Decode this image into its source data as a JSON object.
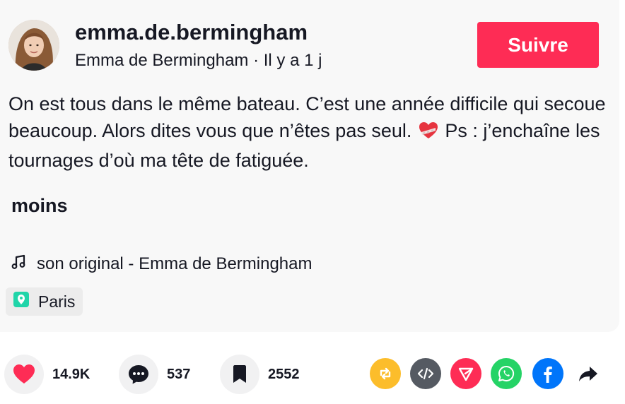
{
  "author": {
    "username": "emma.de.bermingham",
    "display_name": "Emma de Bermingham",
    "time_ago": "Il y a 1 j",
    "meta_separator": " · "
  },
  "follow_label": "Suivre",
  "caption": {
    "text_before_emoji": "On est tous dans le même bateau. C’est une année difficile qui secoue beaucoup. Alors dites vous que n’êtes pas seul.",
    "text_after_emoji": "Ps : j’enchaîne les tournages d’où ma tête de fatiguée.",
    "less_label": "moins"
  },
  "music": {
    "label": "son original - Emma de Bermingham",
    "icon": "music-note-icon"
  },
  "location": {
    "label": "Paris",
    "icon": "location-pin-icon"
  },
  "stats": {
    "likes": "14.9K",
    "comments": "537",
    "saves": "2552"
  },
  "share_icons": [
    "repost-icon",
    "embed-icon",
    "send-icon",
    "whatsapp-icon",
    "facebook-icon",
    "share-arrow-icon"
  ],
  "colors": {
    "accent": "#fe2c55",
    "repost": "#fcbd2b",
    "embed": "#555a62",
    "send": "#fe2c55",
    "whatsapp": "#25d366",
    "facebook": "#0075fa",
    "location_pin": "#20d5a9"
  }
}
